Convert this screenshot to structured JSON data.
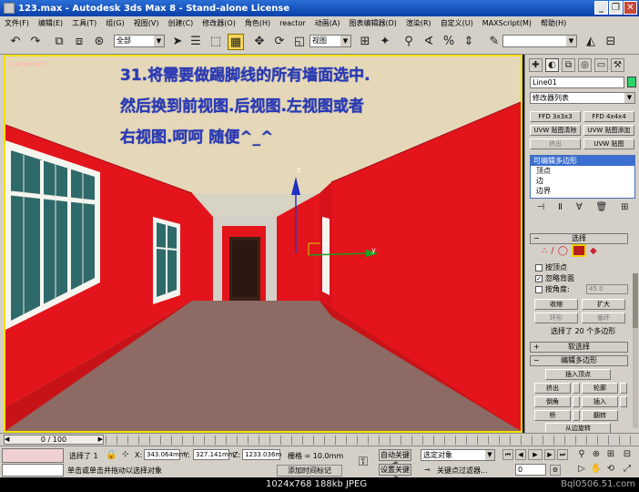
{
  "titlebar": {
    "title": "123.max - Autodesk 3ds Max 8 - Stand-alone License"
  },
  "menus": [
    "文件(F)",
    "编辑(E)",
    "工具(T)",
    "组(G)",
    "视图(V)",
    "创建(C)",
    "修改器(O)",
    "角色(H)",
    "reactor",
    "动画(A)",
    "图表编辑器(D)",
    "渲染(R)",
    "自定义(U)",
    "MAXScript(M)",
    "帮助(H)"
  ],
  "toolbar": {
    "filter": "全部",
    "refcoord": "视图"
  },
  "viewport": {
    "label": "Camera02",
    "caption": [
      "31.将需要做踢脚线的所有墙面选中.",
      "然后换到前视图.后视图.左视图或者",
      "右视图.呵呵  随便^_^"
    ],
    "gizmo_y": "y",
    "gizmo_z": "z",
    "colors": {
      "wall": "#e3141b",
      "ceiling": "#e5d8b8",
      "floor": "#8d6a63"
    }
  },
  "panel": {
    "object_name": "Line01",
    "modifier_list": "修改器列表",
    "buttons": [
      "FFD 3x3x3",
      "FFD 4x4x4",
      "UVW 贴图清除",
      "UVW 贴图添加",
      "挤出",
      "UVW 贴图"
    ],
    "stack": [
      "可编辑多边形",
      "顶点",
      "边",
      "边界"
    ],
    "select_rollout": "选择",
    "by_vertex": "按顶点",
    "ignore_backface": "忽略背面",
    "by_angle": "按角度:",
    "angle_value": "45.0",
    "shrink": "收缩",
    "grow": "扩大",
    "ring": "环形",
    "loop": "循环",
    "selected_info": "选择了 20 个多边形",
    "soft_select": "软选择",
    "edit_poly": "编辑多边形",
    "insert_vertex": "插入顶点",
    "extrude": "挤出",
    "outline": "轮廓",
    "bevel": "倒角",
    "inset": "插入",
    "bridge": "桥",
    "flip": "翻转",
    "hinge": "从边旋转"
  },
  "timeline": {
    "frame": "0 / 100"
  },
  "status": {
    "selected": "选择了 1",
    "x": "343.064mm",
    "y": "327.141mm",
    "z": "1233.036m",
    "grid": "栅格 = 10.0mm",
    "prompt": "单击或单击并拖动以选择对象",
    "add_time_tag": "添加时间标记",
    "auto_key": "自动关键点",
    "set_key": "设置关键点",
    "selected_obj": "选定对象",
    "key_filters": "关键点过滤器...",
    "frame_value": "0"
  },
  "footer": {
    "resolution": "1024x768  188kb  JPEG",
    "watermark": "Bql0506.51.com"
  }
}
